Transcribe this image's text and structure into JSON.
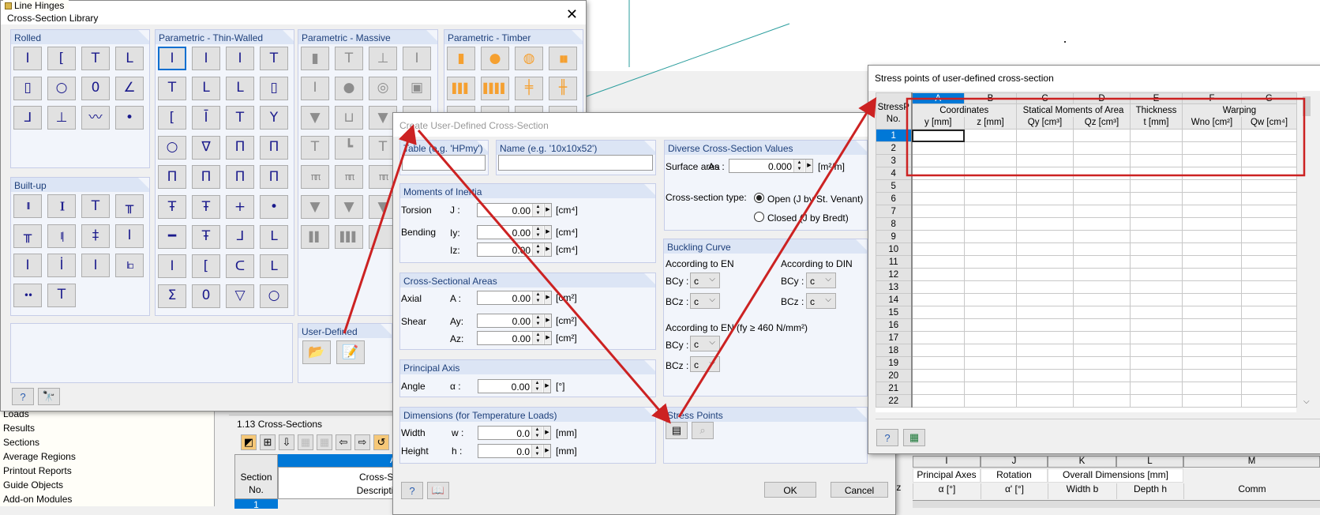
{
  "background": {
    "tree_top_item": "Line Hinges",
    "tree_items": [
      "Loads",
      "Results",
      "Sections",
      "Average Regions",
      "Printout Reports",
      "Guide Objects",
      "Add-on Modules"
    ],
    "table_title": "1.13 Cross-Sections",
    "table_left": {
      "col_letter": "A",
      "section_no": [
        "Section",
        "No."
      ],
      "cross_sec": [
        "Cross-Se",
        "Descriptio"
      ],
      "row1": "1"
    },
    "table_right": {
      "partial_label": ".z",
      "letters": [
        "I",
        "J",
        "K",
        "L",
        "M"
      ],
      "head1": [
        "Principal Axes",
        "Rotation",
        "Overall Dimensions [mm]",
        ""
      ],
      "head2": [
        "α [°]",
        "α' [°]",
        "Width b",
        "Depth h",
        "Comm"
      ]
    }
  },
  "library": {
    "title": "Cross-Section Library",
    "close_icon": "close-icon",
    "groups": {
      "rolled": {
        "label": "Rolled",
        "icons": [
          "I",
          "[",
          "T",
          "L",
          "▯",
          "○",
          "0",
          "∠",
          "ᒧ",
          "⊥",
          "〰",
          "•"
        ]
      },
      "thin": {
        "label": "Parametric - Thin-Walled",
        "icons": [
          "I",
          "I",
          "I",
          "T",
          "T",
          "L",
          "L",
          "▯",
          "[",
          "Ī",
          "T",
          "Y",
          "○",
          "∇",
          "Π",
          "Π",
          "Π",
          "Π",
          "Π",
          "Π",
          "Ŧ",
          "Ŧ",
          "+",
          "•",
          "━",
          "Ŧ",
          "ᒧ",
          "ᒪ",
          "I",
          "[",
          "ᑕ",
          "ᒪ",
          "Σ",
          "0",
          "▽",
          "○"
        ]
      },
      "massive": {
        "label": "Parametric - Massive",
        "icons": [
          "▮",
          "T",
          "⊥",
          "I",
          "I",
          "●",
          "◎",
          "▣",
          "▼",
          "⊔",
          "▼",
          "⊔",
          "T",
          "┗",
          "T",
          "┗",
          "ππ",
          "ππ",
          "ππ",
          "ππ",
          "▼",
          "▼",
          "▼",
          "▼",
          "▌▌",
          "▌▌▌",
          "",
          ""
        ]
      },
      "timber": {
        "label": "Parametric - Timber",
        "icons": [
          "▮",
          "●",
          "◍",
          "▮▮",
          "▌▌▌",
          "▌▌▌▌",
          "╪",
          "╫",
          "▮",
          "▮",
          "▮",
          "▮"
        ]
      },
      "builtup": {
        "label": "Built-up",
        "icons": [
          "II",
          "][",
          "T",
          "╥",
          "╥",
          "I|",
          "‡",
          "I",
          "I",
          "İ",
          "I",
          "I▫",
          "••",
          "T"
        ]
      },
      "user": {
        "label": "User-Defined",
        "open_icon": "folder-open-icon",
        "edit_icon": "edit-pencil-icon"
      }
    },
    "footer": {
      "help_icon": "help-icon",
      "search_icon": "binoculars-icon"
    }
  },
  "create": {
    "title": "Create User-Defined Cross-Section",
    "table_label": "Table (e.g. 'HPmy')",
    "table_value": "",
    "name_label": "Name (e.g. '10x10x52')",
    "name_value": "",
    "moments": {
      "label": "Moments of Inertia",
      "torsion": "Torsion",
      "bending": "Bending",
      "J": "J :",
      "Iy": "Iy:",
      "Iz": "Iz:",
      "J_val": "0.00",
      "Iy_val": "0.00",
      "Iz_val": "0.00",
      "unit": "[cm⁴]"
    },
    "areas": {
      "label": "Cross-Sectional Areas",
      "axial": "Axial",
      "shear": "Shear",
      "A": "A :",
      "Ay": "Ay:",
      "Az": "Az:",
      "A_val": "0.00",
      "Ay_val": "0.00",
      "Az_val": "0.00",
      "unit": "[cm²]"
    },
    "principal": {
      "label": "Principal Axis",
      "angle": "Angle",
      "alpha": "α :",
      "val": "0.00",
      "unit": "[°]"
    },
    "dims": {
      "label": "Dimensions (for Temperature Loads)",
      "width": "Width",
      "height": "Height",
      "w": "w :",
      "h": "h :",
      "w_val": "0.0",
      "h_val": "0.0",
      "unit": "[mm]"
    },
    "diverse": {
      "label": "Diverse Cross-Section Values",
      "surface": "Surface area",
      "As": "As :",
      "As_val": "0.000",
      "unit": "[m²/m]",
      "type_label": "Cross-section type:",
      "open": "Open (J by St. Venant)",
      "closed": "Closed (J by Bredt)",
      "selected": "open"
    },
    "buckling": {
      "label": "Buckling Curve",
      "en": "According to EN",
      "din": "According to DIN",
      "en460": "According to EN (fy ≥ 460 N/mm²)",
      "bcy": "BCy :",
      "bcz": "BCz :",
      "value": "c"
    },
    "stress": {
      "label": "Stress Points",
      "edit_icon": "stress-points-edit-icon",
      "graphic_icon": "stress-points-graphic-icon"
    },
    "ok": "OK",
    "cancel": "Cancel"
  },
  "stress_dialog": {
    "title": "Stress points of user-defined cross-section",
    "letters": [
      "A",
      "B",
      "C",
      "D",
      "E",
      "F",
      "G"
    ],
    "corner": [
      "StressP",
      "No."
    ],
    "groups": [
      "Coordinates",
      "Statical Moments of Area",
      "Thickness",
      "Warping"
    ],
    "subheads": [
      "y [mm]",
      "z [mm]",
      "Qy [cm³]",
      "Qz [cm³]",
      "t [mm]",
      "Wno [cm²]",
      "Qw [cm⁴]"
    ],
    "rows": [
      "1",
      "2",
      "3",
      "4",
      "5",
      "6",
      "7",
      "8",
      "9",
      "10",
      "11",
      "12",
      "13",
      "14",
      "15",
      "16",
      "17",
      "18",
      "19",
      "20",
      "21",
      "22"
    ],
    "selected_row": "1",
    "footer": {
      "help_icon": "help-icon",
      "excel_icon": "excel-export-icon"
    }
  },
  "colors": {
    "annotation": "#cc2222",
    "selection": "#0078d7",
    "teal_line": "#2a9d9d"
  }
}
